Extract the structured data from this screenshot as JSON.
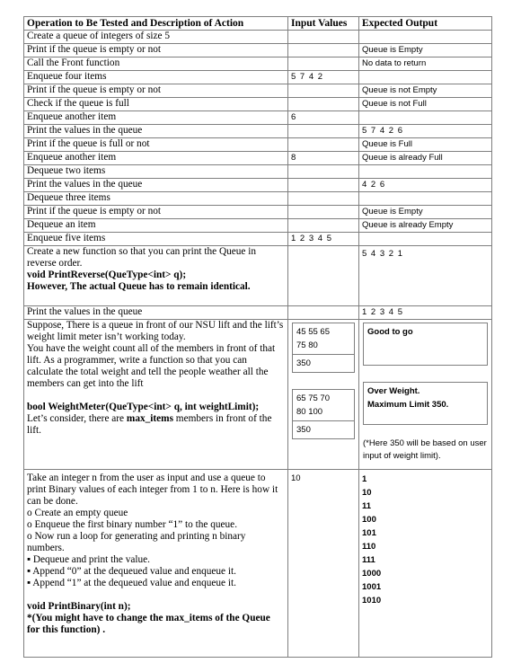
{
  "headers": [
    "Operation to Be Tested and Description of Action",
    "Input Values",
    "Expected Output"
  ],
  "rows": [
    {
      "op": "Create a queue of integers of size 5",
      "input": "",
      "output": ""
    },
    {
      "op": "Print if the queue is empty or not",
      "input": "",
      "output": "Queue is Empty"
    },
    {
      "op": "Call the Front function",
      "input": "",
      "output": "No data to return"
    },
    {
      "op": "Enqueue four  items",
      "input": "5 7 4 2",
      "output": ""
    },
    {
      "op": "Print if the queue is empty or not",
      "input": "",
      "output": "Queue is not Empty"
    },
    {
      "op": "Check if the queue is full",
      "input": "",
      "output": "Queue is not Full"
    },
    {
      "op": "Enqueue another item",
      "input": "6",
      "output": ""
    },
    {
      "op": "Print the values in the queue",
      "input": "",
      "output": "5 7 4 2 6"
    },
    {
      "op": "Print if the queue is full or not",
      "input": "",
      "output": "Queue is Full"
    },
    {
      "op": "Enqueue another item",
      "input": "8",
      "output": "Queue is already Full"
    },
    {
      "op": "Dequeue  two items",
      "input": "",
      "output": ""
    },
    {
      "op": "Print the values in the queue",
      "input": "",
      "output": "4 2 6"
    },
    {
      "op": "Dequeue three items",
      "input": "",
      "output": ""
    },
    {
      "op": "Print if the queue is empty or not",
      "input": "",
      "output": "Queue is Empty"
    },
    {
      "op": "Dequeue an item",
      "input": "",
      "output": "Queue is already Empty"
    },
    {
      "op": "Enqueue five items",
      "input": "1 2 3 4 5",
      "output": ""
    }
  ],
  "reverse": {
    "text": "Create a new function so that you can print the Queue in reverse order.",
    "sig": "void PrintReverse(QueType<int> q);",
    "note": "However, The actual Queue has to remain identical.",
    "output": "5 4 3 2 1"
  },
  "print_row": {
    "op": "Print the values in the queue",
    "output": "1 2 3 4 5"
  },
  "weight": {
    "p1": "Suppose, There is a queue in front of our NSU lift and the lift’s weight limit meter isn’t working today.",
    "p2": "You have the weight count all of the members in front of that lift. As a programmer, write a function so that you can calculate the total weight and tell the people weather all the members can get into the lift",
    "sig": "bool WeightMeter(QueType<int> q, int weightLimit);",
    "p3a": "Let’s consider, there are ",
    "p3b": "max_items",
    "p3c": " members in front of the lift.",
    "in1a": "45 55 65",
    "in1b": "75 80",
    "in1c": "350",
    "in2a": "65 75 70",
    "in2b": "80 100",
    "in2c": "350",
    "out1": "Good to go",
    "out2a": "Over Weight.",
    "out2b": "Maximum Limit 350.",
    "note": "(*Here 350 will be based on user input of weight limit)."
  },
  "binary": {
    "lines": [
      "Take an integer n from the user as input and use a queue to print Binary values of each integer from 1 to n. Here is how it can be done.",
      "o Create an empty queue",
      "o Enqueue the first binary number “1” to the queue.",
      "o Now run a loop for generating and printing n binary numbers.",
      "▪ Dequeue and print the value.",
      "▪ Append “0” at the dequeued value and enqueue it.",
      "▪ Append “1” at the dequeued value and enqueue it."
    ],
    "sig": "void PrintBinary(int n);",
    "note": "*(You might have to change the max_items of the Queue  for this function) .",
    "input": "10",
    "outputs": [
      "1",
      "10",
      "11",
      "100",
      "101",
      "110",
      "111",
      "1000",
      "1001",
      "1010"
    ]
  }
}
